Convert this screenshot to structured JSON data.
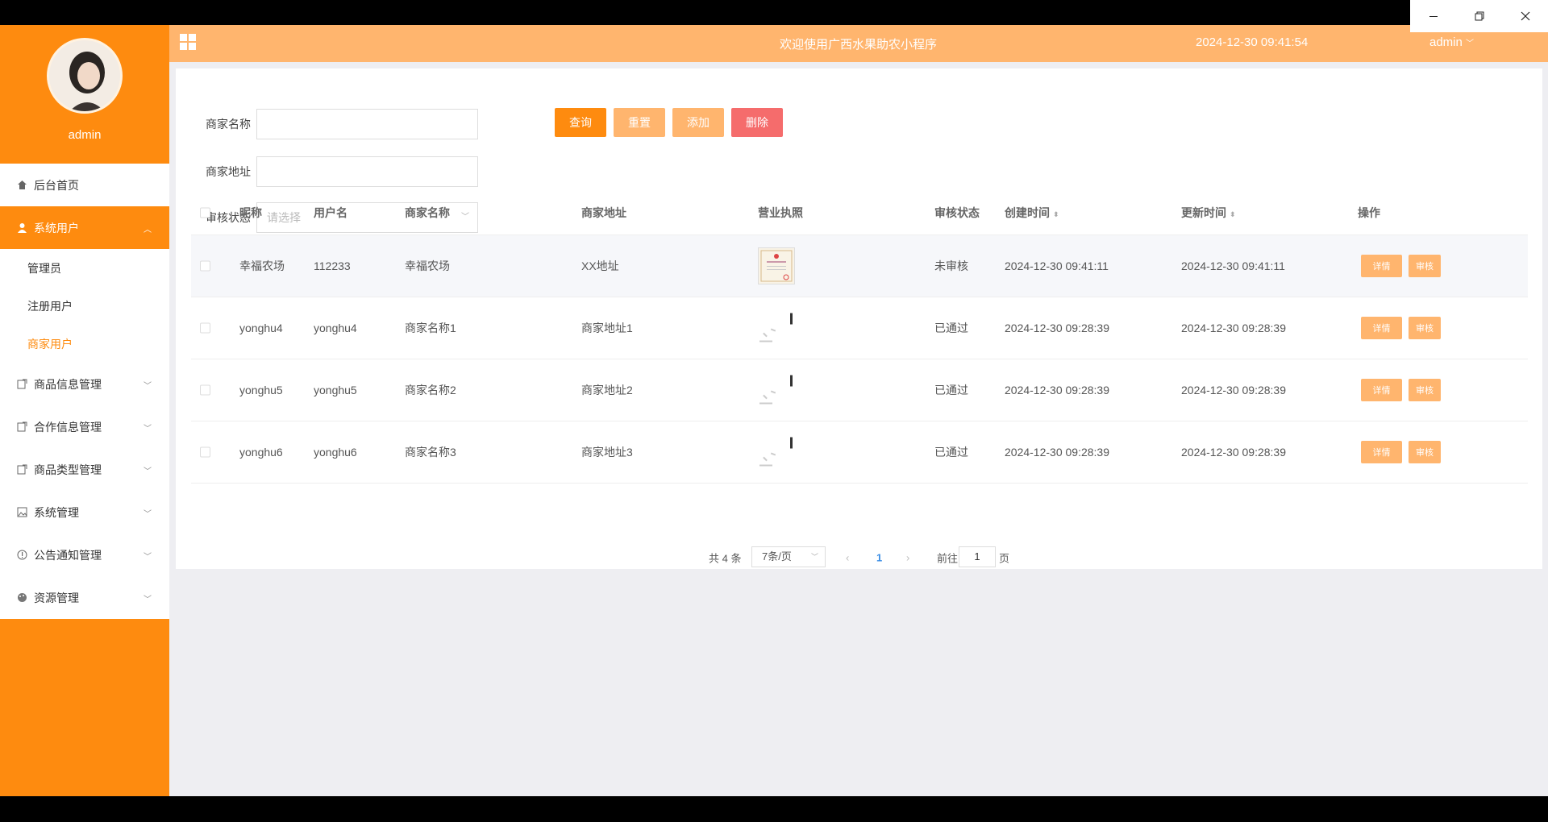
{
  "sidebar": {
    "username": "admin",
    "menu": [
      {
        "label": "后台首页",
        "icon": "home-icon"
      },
      {
        "label": "系统用户",
        "icon": "user-icon",
        "active": true
      },
      {
        "label": "商品信息管理",
        "icon": "edit-icon"
      },
      {
        "label": "合作信息管理",
        "icon": "edit-icon"
      },
      {
        "label": "商品类型管理",
        "icon": "edit-icon"
      },
      {
        "label": "系统管理",
        "icon": "image-icon"
      },
      {
        "label": "公告通知管理",
        "icon": "info-icon"
      },
      {
        "label": "资源管理",
        "icon": "palette-icon"
      }
    ],
    "submenu": [
      "管理员",
      "注册用户",
      "商家用户"
    ]
  },
  "topbar": {
    "title": "欢迎使用广西水果助农小程序",
    "datetime": "2024-12-30 09:41:54",
    "user": "admin"
  },
  "search": {
    "merchant_name_label": "商家名称",
    "merchant_address_label": "商家地址",
    "audit_status_label": "审核状态",
    "audit_status_placeholder": "请选择",
    "buttons": {
      "query": "查询",
      "reset": "重置",
      "add": "添加",
      "delete": "删除"
    }
  },
  "table": {
    "headers": [
      "昵称",
      "用户名",
      "商家名称",
      "商家地址",
      "营业执照",
      "审核状态",
      "创建时间",
      "更新时间",
      "操作"
    ],
    "rows": [
      {
        "nickname": "幸福农场",
        "username": "112233",
        "merchant_name": "幸福农场",
        "address": "XX地址",
        "status": "未审核",
        "created": "2024-12-30 09:41:11",
        "updated": "2024-12-30 09:41:11"
      },
      {
        "nickname": "yonghu4",
        "username": "yonghu4",
        "merchant_name": "商家名称1",
        "address": "商家地址1",
        "status": "已通过",
        "created": "2024-12-30 09:28:39",
        "updated": "2024-12-30 09:28:39"
      },
      {
        "nickname": "yonghu5",
        "username": "yonghu5",
        "merchant_name": "商家名称2",
        "address": "商家地址2",
        "status": "已通过",
        "created": "2024-12-30 09:28:39",
        "updated": "2024-12-30 09:28:39"
      },
      {
        "nickname": "yonghu6",
        "username": "yonghu6",
        "merchant_name": "商家名称3",
        "address": "商家地址3",
        "status": "已通过",
        "created": "2024-12-30 09:28:39",
        "updated": "2024-12-30 09:28:39"
      }
    ],
    "detail_label": "详情",
    "audit_label": "审核"
  },
  "pagination": {
    "total": "共 4 条",
    "page_size": "7条/页",
    "current_page": "1",
    "goto_label": "前往",
    "goto_value": "1",
    "page_suffix": "页"
  },
  "colors": {
    "primary": "#fe8b0f",
    "light": "#ffb56e",
    "danger": "#f56c6c"
  }
}
